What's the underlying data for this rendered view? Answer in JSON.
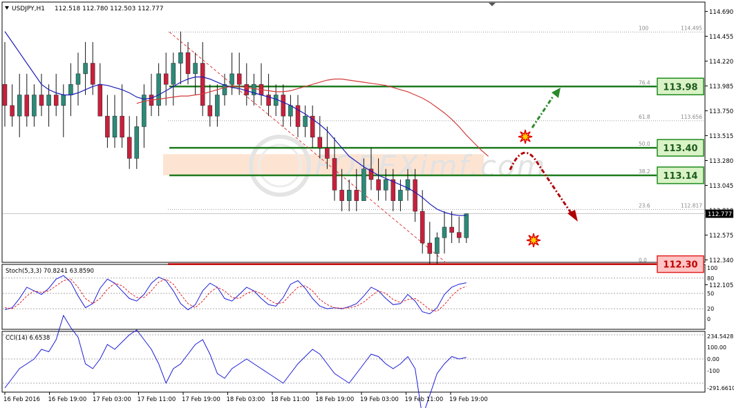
{
  "header": {
    "symbol": "USDJPY,H1",
    "ohlc": "112.518 112.780 112.503 112.777"
  },
  "price_axis": {
    "ticks": [
      "114.690",
      "114.455",
      "114.220",
      "113.985",
      "113.750",
      "113.515",
      "113.280",
      "113.045",
      "112.810",
      "112.575",
      "112.340",
      "112.105"
    ],
    "current_price": "112.777",
    "current_price_value": 112.777
  },
  "fib_levels": [
    {
      "ratio": "100",
      "price_label": "114.495",
      "value": 114.495
    },
    {
      "ratio": "76.4",
      "price_label": "",
      "value": 113.98
    },
    {
      "ratio": "61.8",
      "price_label": "113.656",
      "value": 113.656
    },
    {
      "ratio": "50.0",
      "price_label": "",
      "value": 113.4
    },
    {
      "ratio": "38.2",
      "price_label": "",
      "value": 113.14
    },
    {
      "ratio": "23.6",
      "price_label": "112.817",
      "value": 112.817
    },
    {
      "ratio": "0.0",
      "price_label": "",
      "value": 112.3
    }
  ],
  "level_boxes": [
    {
      "label": "113.98",
      "value": 113.98,
      "kind": "resistance"
    },
    {
      "label": "113.40",
      "value": 113.4,
      "kind": "resistance"
    },
    {
      "label": "113.14",
      "value": 113.14,
      "kind": "resistance"
    },
    {
      "label": "112.30",
      "value": 112.3,
      "kind": "support"
    }
  ],
  "colors": {
    "bull_candle": "#2d8a78",
    "bear_candle": "#c8203c",
    "green_level": "#1d7a1d",
    "red_level": "#c00000",
    "ma_fast": "#1c1cb8",
    "ma_slow": "#d43a3a",
    "zone": "#fde4d2"
  },
  "watermark": "FOREXimf.com",
  "stoch": {
    "label": "Stoch(5,3,3) 70.8241 63.8590",
    "ticks": [
      "100",
      "80",
      "50",
      "20",
      "0"
    ]
  },
  "cci": {
    "label": "CCI(14) 6.6538",
    "ticks": [
      "234.5428",
      "100.00",
      "0.00",
      "-100",
      "-291.6610"
    ]
  },
  "time_axis": [
    "16 Feb 2016",
    "16 Feb 19:00",
    "17 Feb 03:00",
    "17 Feb 11:00",
    "17 Feb 19:00",
    "18 Feb 03:00",
    "18 Feb 11:00",
    "18 Feb 19:00",
    "19 Feb 03:00",
    "19 Feb 11:00",
    "19 Feb 19:00"
  ],
  "chart_data": {
    "type": "candlestick",
    "title": "USDJPY,H1",
    "ylim": [
      112.06,
      114.73
    ],
    "series": [
      {
        "name": "USDJPY H1",
        "ohlc": [
          [
            114.0,
            114.4,
            113.6,
            113.8
          ],
          [
            113.8,
            114.0,
            113.6,
            113.7
          ],
          [
            113.7,
            114.1,
            113.5,
            113.9
          ],
          [
            113.9,
            114.1,
            113.6,
            113.7
          ],
          [
            113.7,
            114.0,
            113.6,
            113.9
          ],
          [
            113.9,
            114.1,
            113.7,
            113.8
          ],
          [
            113.8,
            114.0,
            113.6,
            113.9
          ],
          [
            113.9,
            114.1,
            113.7,
            113.8
          ],
          [
            113.8,
            114.0,
            113.5,
            113.9
          ],
          [
            113.9,
            114.2,
            113.7,
            114.0
          ],
          [
            114.0,
            114.3,
            113.8,
            114.1
          ],
          [
            114.1,
            114.4,
            113.9,
            114.2
          ],
          [
            114.2,
            114.4,
            113.9,
            114.0
          ],
          [
            114.0,
            114.2,
            113.7,
            113.7
          ],
          [
            113.7,
            113.9,
            113.4,
            113.5
          ],
          [
            113.5,
            113.9,
            113.4,
            113.7
          ],
          [
            113.7,
            114.0,
            113.4,
            113.5
          ],
          [
            113.5,
            113.7,
            113.2,
            113.3
          ],
          [
            113.3,
            113.7,
            113.2,
            113.6
          ],
          [
            113.6,
            114.0,
            113.4,
            113.9
          ],
          [
            113.9,
            114.1,
            113.7,
            113.8
          ],
          [
            113.8,
            114.2,
            113.7,
            114.1
          ],
          [
            114.1,
            114.3,
            113.8,
            114.0
          ],
          [
            114.0,
            114.3,
            113.8,
            114.2
          ],
          [
            114.2,
            114.5,
            114.0,
            114.3
          ],
          [
            114.3,
            114.4,
            114.0,
            114.1
          ],
          [
            114.1,
            114.3,
            113.9,
            114.2
          ],
          [
            114.2,
            114.4,
            113.7,
            113.8
          ],
          [
            113.8,
            114.0,
            113.6,
            113.7
          ],
          [
            113.7,
            114.0,
            113.6,
            113.9
          ],
          [
            113.9,
            114.1,
            113.8,
            114.0
          ],
          [
            114.0,
            114.3,
            113.9,
            114.1
          ],
          [
            114.1,
            114.3,
            113.9,
            114.0
          ],
          [
            114.0,
            114.2,
            113.8,
            113.9
          ],
          [
            113.9,
            114.1,
            113.8,
            114.0
          ],
          [
            114.0,
            114.2,
            113.8,
            113.9
          ],
          [
            113.9,
            114.1,
            113.7,
            113.8
          ],
          [
            113.8,
            114.0,
            113.7,
            113.9
          ],
          [
            113.9,
            114.0,
            113.6,
            113.7
          ],
          [
            113.7,
            113.9,
            113.6,
            113.8
          ],
          [
            113.8,
            113.9,
            113.5,
            113.6
          ],
          [
            113.6,
            113.8,
            113.5,
            113.7
          ],
          [
            113.7,
            113.8,
            113.4,
            113.5
          ],
          [
            113.5,
            113.7,
            113.3,
            113.4
          ],
          [
            113.4,
            113.6,
            113.2,
            113.3
          ],
          [
            113.3,
            113.5,
            112.9,
            113.0
          ],
          [
            113.0,
            113.2,
            112.8,
            112.9
          ],
          [
            112.9,
            113.1,
            112.8,
            113.0
          ],
          [
            113.0,
            113.2,
            112.8,
            112.9
          ],
          [
            112.9,
            113.3,
            112.9,
            113.2
          ],
          [
            113.2,
            113.4,
            113.0,
            113.1
          ],
          [
            113.1,
            113.3,
            112.9,
            113.0
          ],
          [
            113.0,
            113.2,
            112.9,
            113.1
          ],
          [
            113.1,
            113.2,
            112.8,
            112.9
          ],
          [
            112.9,
            113.1,
            112.8,
            113.0
          ],
          [
            113.0,
            113.2,
            112.9,
            113.1
          ],
          [
            113.1,
            113.2,
            112.7,
            112.8
          ],
          [
            112.8,
            113.0,
            112.4,
            112.5
          ],
          [
            112.5,
            112.7,
            112.3,
            112.4
          ],
          [
            112.4,
            112.6,
            112.3,
            112.55
          ],
          [
            112.55,
            112.8,
            112.4,
            112.65
          ],
          [
            112.65,
            112.8,
            112.5,
            112.6
          ],
          [
            112.6,
            112.75,
            112.5,
            112.55
          ],
          [
            112.55,
            112.78,
            112.5,
            112.777
          ]
        ]
      },
      {
        "name": "fast MA",
        "values": [
          114.5,
          114.4,
          114.3,
          114.2,
          114.1,
          114.0,
          113.95,
          113.92,
          113.9,
          113.9,
          113.92,
          113.95,
          113.98,
          114.0,
          113.99,
          113.97,
          113.95,
          113.92,
          113.88,
          113.86,
          113.87,
          113.9,
          113.94,
          113.98,
          114.02,
          114.05,
          114.07,
          114.07,
          114.05,
          114.02,
          113.99,
          113.97,
          113.96,
          113.94,
          113.92,
          113.9,
          113.88,
          113.86,
          113.83,
          113.8,
          113.76,
          113.72,
          113.67,
          113.62,
          113.56,
          113.48,
          113.4,
          113.32,
          113.27,
          113.22,
          113.18,
          113.14,
          113.11,
          113.08,
          113.05,
          113.02,
          112.98,
          112.93,
          112.87,
          112.82,
          112.79,
          112.77,
          112.76,
          112.76
        ]
      },
      {
        "name": "slow MA",
        "values": [
          113.82,
          113.84,
          113.85,
          113.86,
          113.87,
          113.88,
          113.89,
          113.89,
          113.9,
          113.91,
          113.93,
          113.95,
          113.97,
          113.98,
          113.98,
          113.97,
          113.96,
          113.95,
          113.94,
          113.93,
          113.93,
          113.94,
          113.96,
          113.98,
          114.0,
          114.02,
          114.04,
          114.05,
          114.05,
          114.04,
          114.03,
          114.02,
          114.01,
          114.0,
          113.99,
          113.97,
          113.95,
          113.93,
          113.9,
          113.87,
          113.83,
          113.78,
          113.73,
          113.67,
          113.6,
          113.52,
          113.45,
          113.38,
          113.32
        ]
      },
      {
        "name": "Stoch %K",
        "values": [
          18,
          22,
          40,
          62,
          55,
          48,
          60,
          78,
          85,
          72,
          45,
          22,
          30,
          60,
          78,
          70,
          55,
          40,
          35,
          48,
          70,
          82,
          75,
          55,
          30,
          18,
          28,
          55,
          70,
          62,
          40,
          35,
          48,
          62,
          55,
          40,
          28,
          25,
          42,
          68,
          75,
          60,
          40,
          25,
          20,
          22,
          20,
          24,
          30,
          45,
          62,
          55,
          40,
          28,
          30,
          48,
          35,
          14,
          10,
          22,
          48,
          62,
          68,
          70.8
        ]
      },
      {
        "name": "Stoch %D",
        "values": [
          22,
          20,
          30,
          45,
          55,
          52,
          55,
          65,
          75,
          78,
          62,
          40,
          30,
          40,
          58,
          70,
          65,
          52,
          42,
          42,
          55,
          72,
          78,
          68,
          48,
          30,
          22,
          35,
          52,
          62,
          55,
          42,
          40,
          50,
          55,
          50,
          38,
          30,
          32,
          48,
          62,
          65,
          55,
          38,
          28,
          22,
          21,
          22,
          25,
          33,
          45,
          55,
          50,
          38,
          32,
          38,
          40,
          30,
          18,
          15,
          28,
          45,
          58,
          63.9
        ]
      },
      {
        "name": "CCI(14)",
        "values": [
          -120,
          -80,
          -40,
          -20,
          0,
          40,
          30,
          80,
          180,
          130,
          90,
          -20,
          -40,
          0,
          60,
          40,
          70,
          100,
          120,
          80,
          40,
          -20,
          -100,
          -40,
          -20,
          20,
          60,
          80,
          20,
          -60,
          -80,
          -40,
          -20,
          0,
          -20,
          -40,
          -60,
          -80,
          -100,
          -60,
          -20,
          10,
          40,
          20,
          -20,
          -60,
          -80,
          -100,
          -60,
          -20,
          20,
          10,
          -20,
          -40,
          -20,
          10,
          -40,
          -240,
          -150,
          -60,
          -20,
          10,
          0,
          6.65
        ]
      }
    ],
    "x_tick_labels": [
      "16 Feb 2016",
      "16 Feb 19:00",
      "17 Feb 03:00",
      "17 Feb 11:00",
      "17 Feb 19:00",
      "18 Feb 03:00",
      "18 Feb 11:00",
      "18 Feb 19:00",
      "19 Feb 03:00",
      "19 Feb 11:00",
      "19 Feb 19:00"
    ]
  }
}
